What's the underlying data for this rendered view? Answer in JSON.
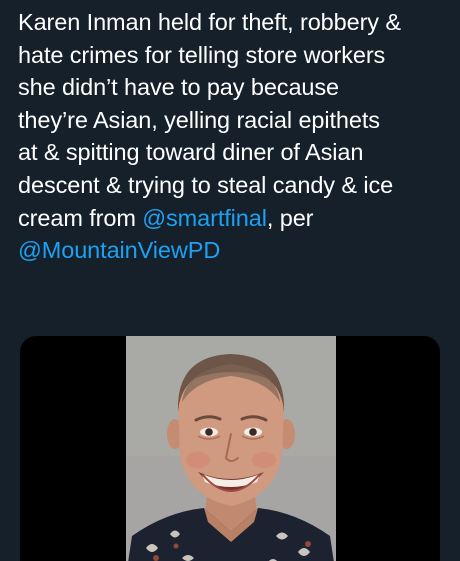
{
  "tweet": {
    "text_lines": {
      "l1": "Karen Inman held for theft, robbery &",
      "l2": "hate crimes for telling store workers",
      "l3": "she didn’t have to pay because",
      "l4": "they’re Asian, yelling racial epithets",
      "l5": "at & spitting toward diner of Asian",
      "l6": "descent & trying to steal candy & ice",
      "l7_prefix": "cream from ",
      "l7_suffix": ", per"
    },
    "mention_1": "@smartfinal",
    "mention_2": "@MountainViewPD"
  },
  "colors": {
    "background": "#15202b",
    "text": "#ffffff",
    "link": "#1da1f2"
  }
}
